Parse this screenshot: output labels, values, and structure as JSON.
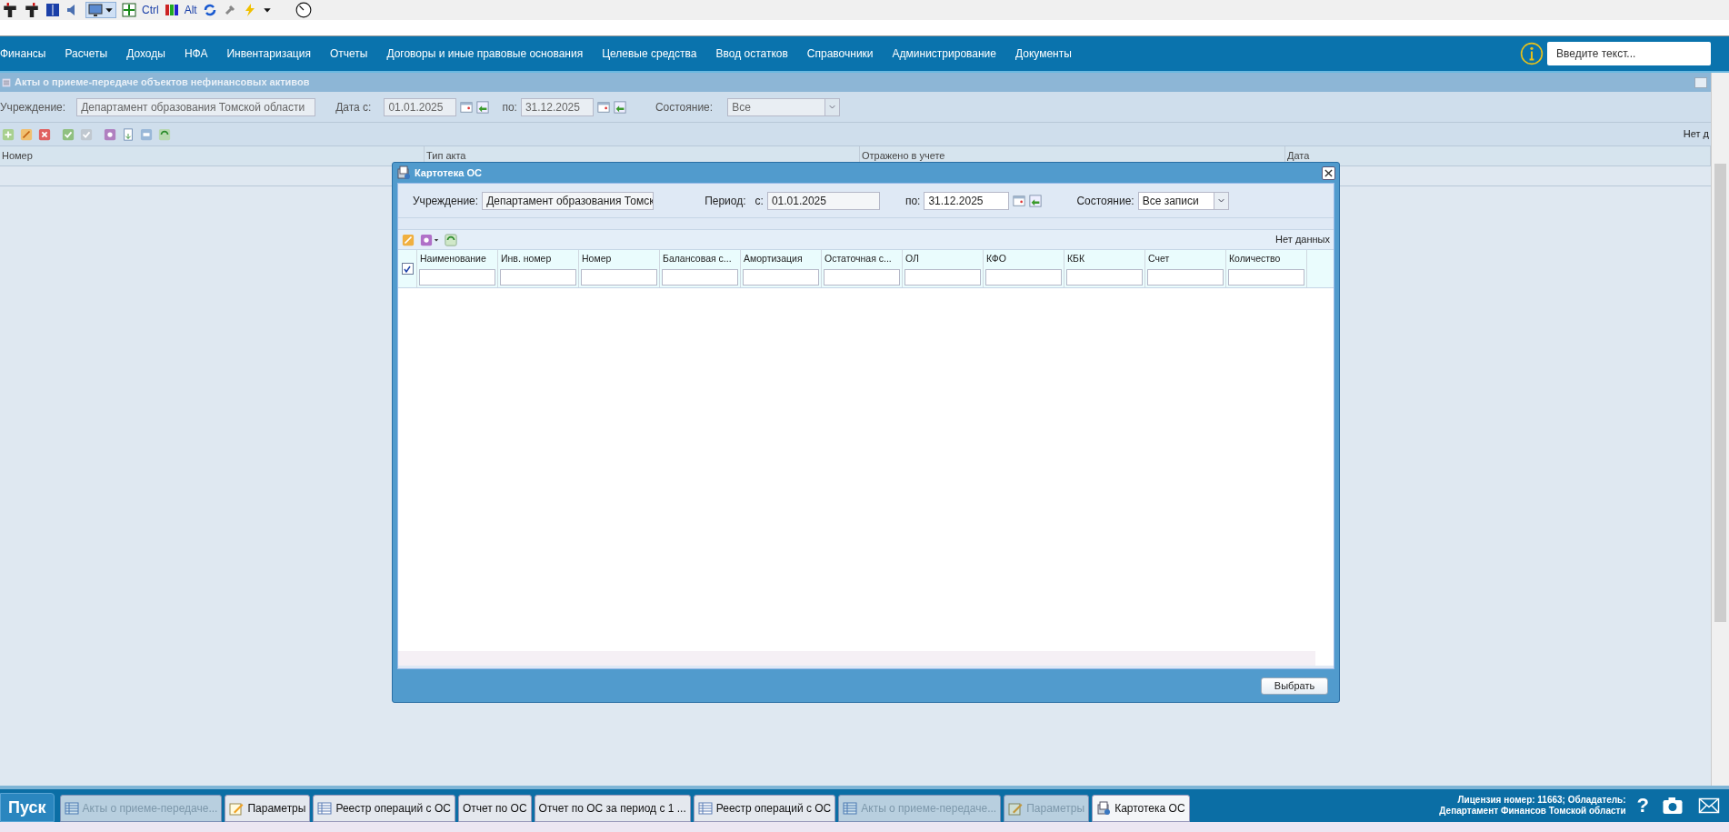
{
  "toolbar": {
    "labels": [
      "Ctrl",
      "Alt"
    ]
  },
  "menu": {
    "items": [
      "Финансы",
      "Расчеты",
      "Доходы",
      "НФА",
      "Инвентаризация",
      "Отчеты",
      "Договоры и иные правовые основания",
      "Целевые средства",
      "Ввод остатков",
      "Справочники",
      "Администрирование",
      "Документы"
    ],
    "search": {
      "placeholder": "Введите текст..."
    }
  },
  "panel": {
    "title": "Акты о приеме-передаче объектов нефинансовых активов",
    "filters": {
      "institution_label": "Учреждение:",
      "institution": "Департамент образования Томской области",
      "date_from_label": "Дата с:",
      "date_from": "01.01.2025",
      "date_to_label": "по:",
      "date_to": "31.12.2025",
      "state_label": "Состояние:",
      "state": "Все"
    },
    "grid": {
      "status": "Нет д",
      "columns": [
        "Номер",
        "Тип акта",
        "Отражено в учете",
        "Дата"
      ]
    }
  },
  "dialog": {
    "title": "Картотека ОС",
    "filters": {
      "institution_label": "Учреждение:",
      "institution": "Департамент образования Томск",
      "period_label": "Период:",
      "from_label": "с:",
      "date_from": "01.01.2025",
      "to_label": "по:",
      "date_to": "31.12.2025",
      "state_label": "Состояние:",
      "state": "Все записи"
    },
    "status": "Нет данных",
    "select_all": {
      "checked": true
    },
    "columns": [
      "Наименование",
      "Инв. номер",
      "Номер",
      "Балансовая с...",
      "Амортизация",
      "Остаточная с...",
      "ОЛ",
      "КФО",
      "КБК",
      "Счет",
      "Количество"
    ],
    "button": "Выбрать"
  },
  "taskbar": {
    "start": "Пуск",
    "items": [
      {
        "label": "Акты о приеме-передаче...",
        "kind": "list",
        "dimmed": true,
        "selected": false
      },
      {
        "label": "Параметры",
        "kind": "params",
        "dimmed": false,
        "selected": false
      },
      {
        "label": "Реестр операций с ОС",
        "kind": "list",
        "dimmed": false,
        "selected": false
      },
      {
        "label": "Отчет по ОС",
        "kind": "plain",
        "dimmed": false,
        "selected": false
      },
      {
        "label": "Отчет по ОС за период с 1 ...",
        "kind": "plain",
        "dimmed": false,
        "selected": false
      },
      {
        "label": "Реестр операций с ОС",
        "kind": "list",
        "dimmed": false,
        "selected": false
      },
      {
        "label": "Акты о приеме-передаче...",
        "kind": "list",
        "dimmed": true,
        "selected": false
      },
      {
        "label": "Параметры",
        "kind": "params",
        "dimmed": true,
        "selected": false
      },
      {
        "label": "Картотека ОС",
        "kind": "cards",
        "dimmed": false,
        "selected": true
      }
    ],
    "help": "?",
    "license": [
      "Лицензия номер: 11663; Обладатель:",
      "Департамент Финансов Томской области"
    ]
  }
}
